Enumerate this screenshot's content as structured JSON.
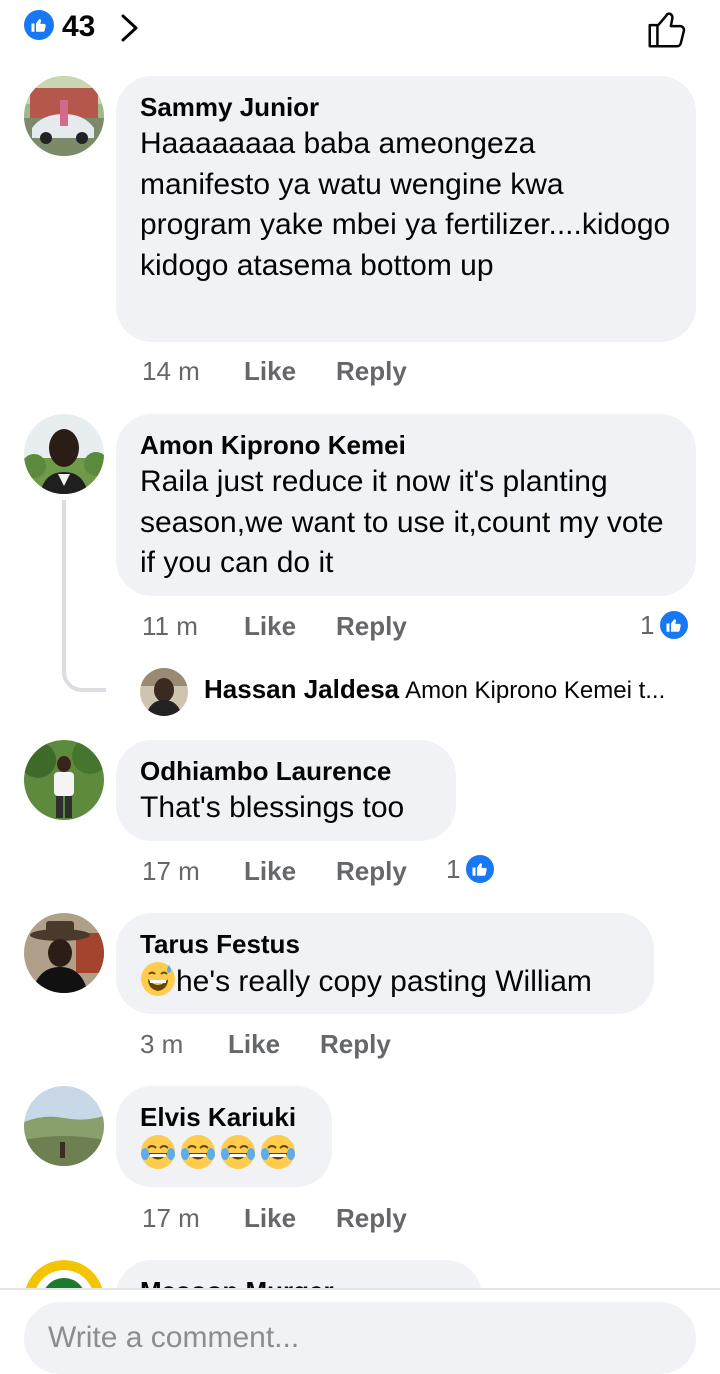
{
  "header": {
    "reaction_count": "43",
    "icons": {
      "reaction": "like-icon",
      "expand": "chevron-right-icon",
      "action": "thumbs-up-outline-icon"
    }
  },
  "colors": {
    "accent": "#1877f2",
    "bubble": "#f0f2f5",
    "meta_text": "#65676b"
  },
  "comments": [
    {
      "author": "Sammy Junior",
      "text": "Haaaaaaaa baba ameongeza manifesto ya watu wengine kwa program yake mbei ya fertilizer....kidogo kidogo atasema bottom up",
      "time": "14 m",
      "like": "Like",
      "reply": "Reply"
    },
    {
      "author": "Amon Kiprono Kemei",
      "text": "Raila just reduce it now it's planting season,we want to use it,count my vote if you can do it",
      "time": "11 m",
      "like": "Like",
      "reply": "Reply",
      "reaction_count": "1",
      "reply_preview": {
        "author": "Hassan Jaldesa",
        "text": "Amon Kiprono Kemei t..."
      }
    },
    {
      "author": "Odhiambo Laurence",
      "text": "That's blessings too",
      "time": "17 m",
      "like": "Like",
      "reply": "Reply",
      "reaction_count": "1"
    },
    {
      "author": "Tarus Festus",
      "text": "he's really copy pasting William",
      "emoji": [
        "grinning-sweat-emoji"
      ],
      "time": "3 m",
      "like": "Like",
      "reply": "Reply"
    },
    {
      "author": "Elvis Kariuki",
      "emoji": [
        "tears-of-joy-emoji",
        "tears-of-joy-emoji",
        "tears-of-joy-emoji",
        "tears-of-joy-emoji"
      ],
      "time": "17 m",
      "like": "Like",
      "reply": "Reply"
    },
    {
      "author": "Masoon Murger"
    }
  ],
  "composer": {
    "placeholder": "Write a comment..."
  }
}
